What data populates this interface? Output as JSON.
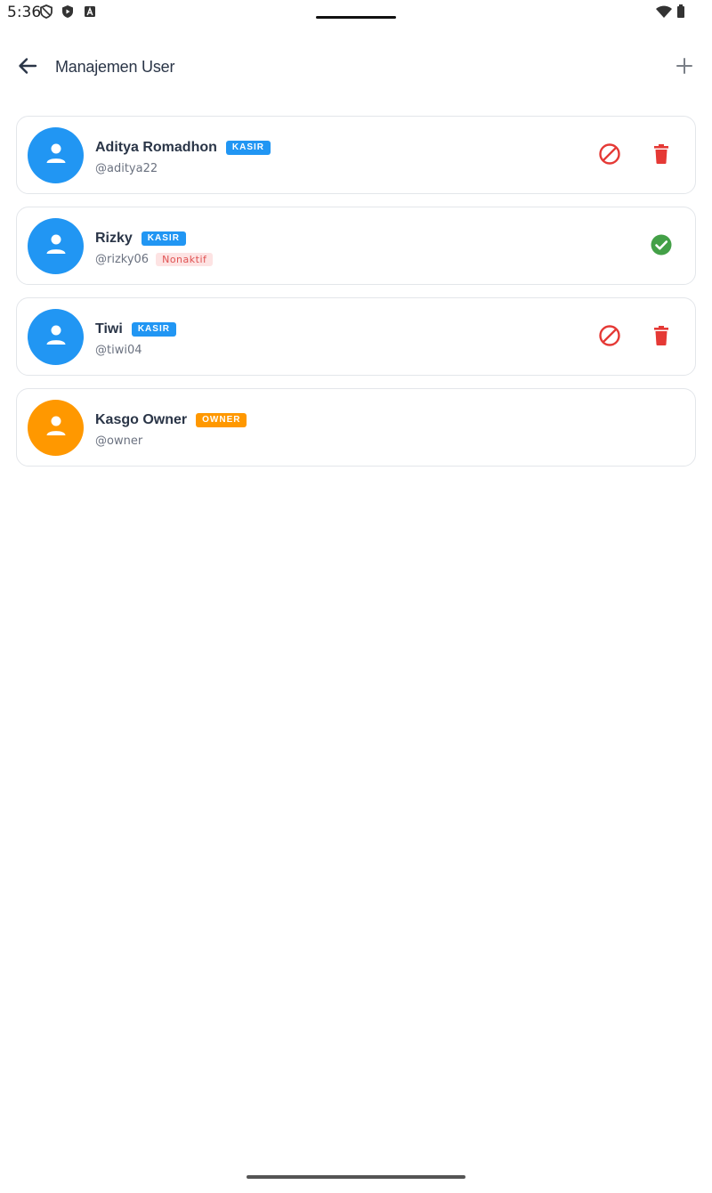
{
  "status_bar": {
    "time": "5:36",
    "left_icons": [
      "shield-icon",
      "play-protect-icon",
      "a-icon"
    ],
    "right_icons": [
      "wifi-icon",
      "battery-icon"
    ]
  },
  "app_bar": {
    "title": "Manajemen User",
    "back_icon": "arrow-back-icon",
    "add_icon": "plus-icon"
  },
  "colors": {
    "kasir": "#2196f3",
    "owner": "#ff9800",
    "danger": "#e53935",
    "success": "#43a047"
  },
  "users": [
    {
      "name": "Aditya Romadhon",
      "role": "KASIR",
      "username": "@aditya22",
      "status": "",
      "actions": [
        "block-icon",
        "delete-icon"
      ]
    },
    {
      "name": "Rizky",
      "role": "KASIR",
      "username": "@rizky06",
      "status": "Nonaktif",
      "actions": [
        "check-circle-icon"
      ]
    },
    {
      "name": "Tiwi",
      "role": "KASIR",
      "username": "@tiwi04",
      "status": "",
      "actions": [
        "block-icon",
        "delete-icon"
      ]
    },
    {
      "name": "Kasgo Owner",
      "role": "OWNER",
      "username": "@owner",
      "status": "",
      "actions": []
    }
  ]
}
